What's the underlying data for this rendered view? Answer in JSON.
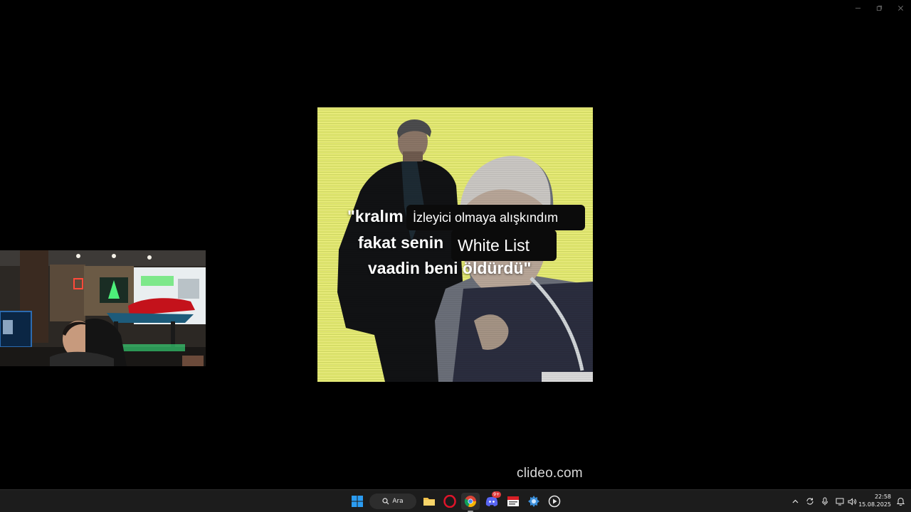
{
  "video": {
    "caption_line1_plain": "\"kralım",
    "caption_line1_boxed": "İzleyici olmaya alışkındım",
    "caption_line2_plain": "fakat senin",
    "caption_line2_boxed": "White List",
    "caption_line3_plain": "vaadin beni öldürdü\""
  },
  "watermark": "clideo.com",
  "taskbar": {
    "search_label": "Ara",
    "discord_badge": "9+",
    "time": "22:58",
    "date": "15.08.2025"
  },
  "icons": {
    "start": "windows-start-icon",
    "search": "search-icon",
    "explorer": "folder-icon",
    "opera": "opera-icon",
    "chrome": "chrome-icon",
    "discord": "discord-icon",
    "news": "news-app-icon",
    "settings": "gear-app-icon",
    "media": "media-player-icon"
  },
  "colors": {
    "taskbar_bg": "#1c1c1c",
    "video_bg": "#e8ec7a",
    "caption_box": "#0b0b0b"
  }
}
